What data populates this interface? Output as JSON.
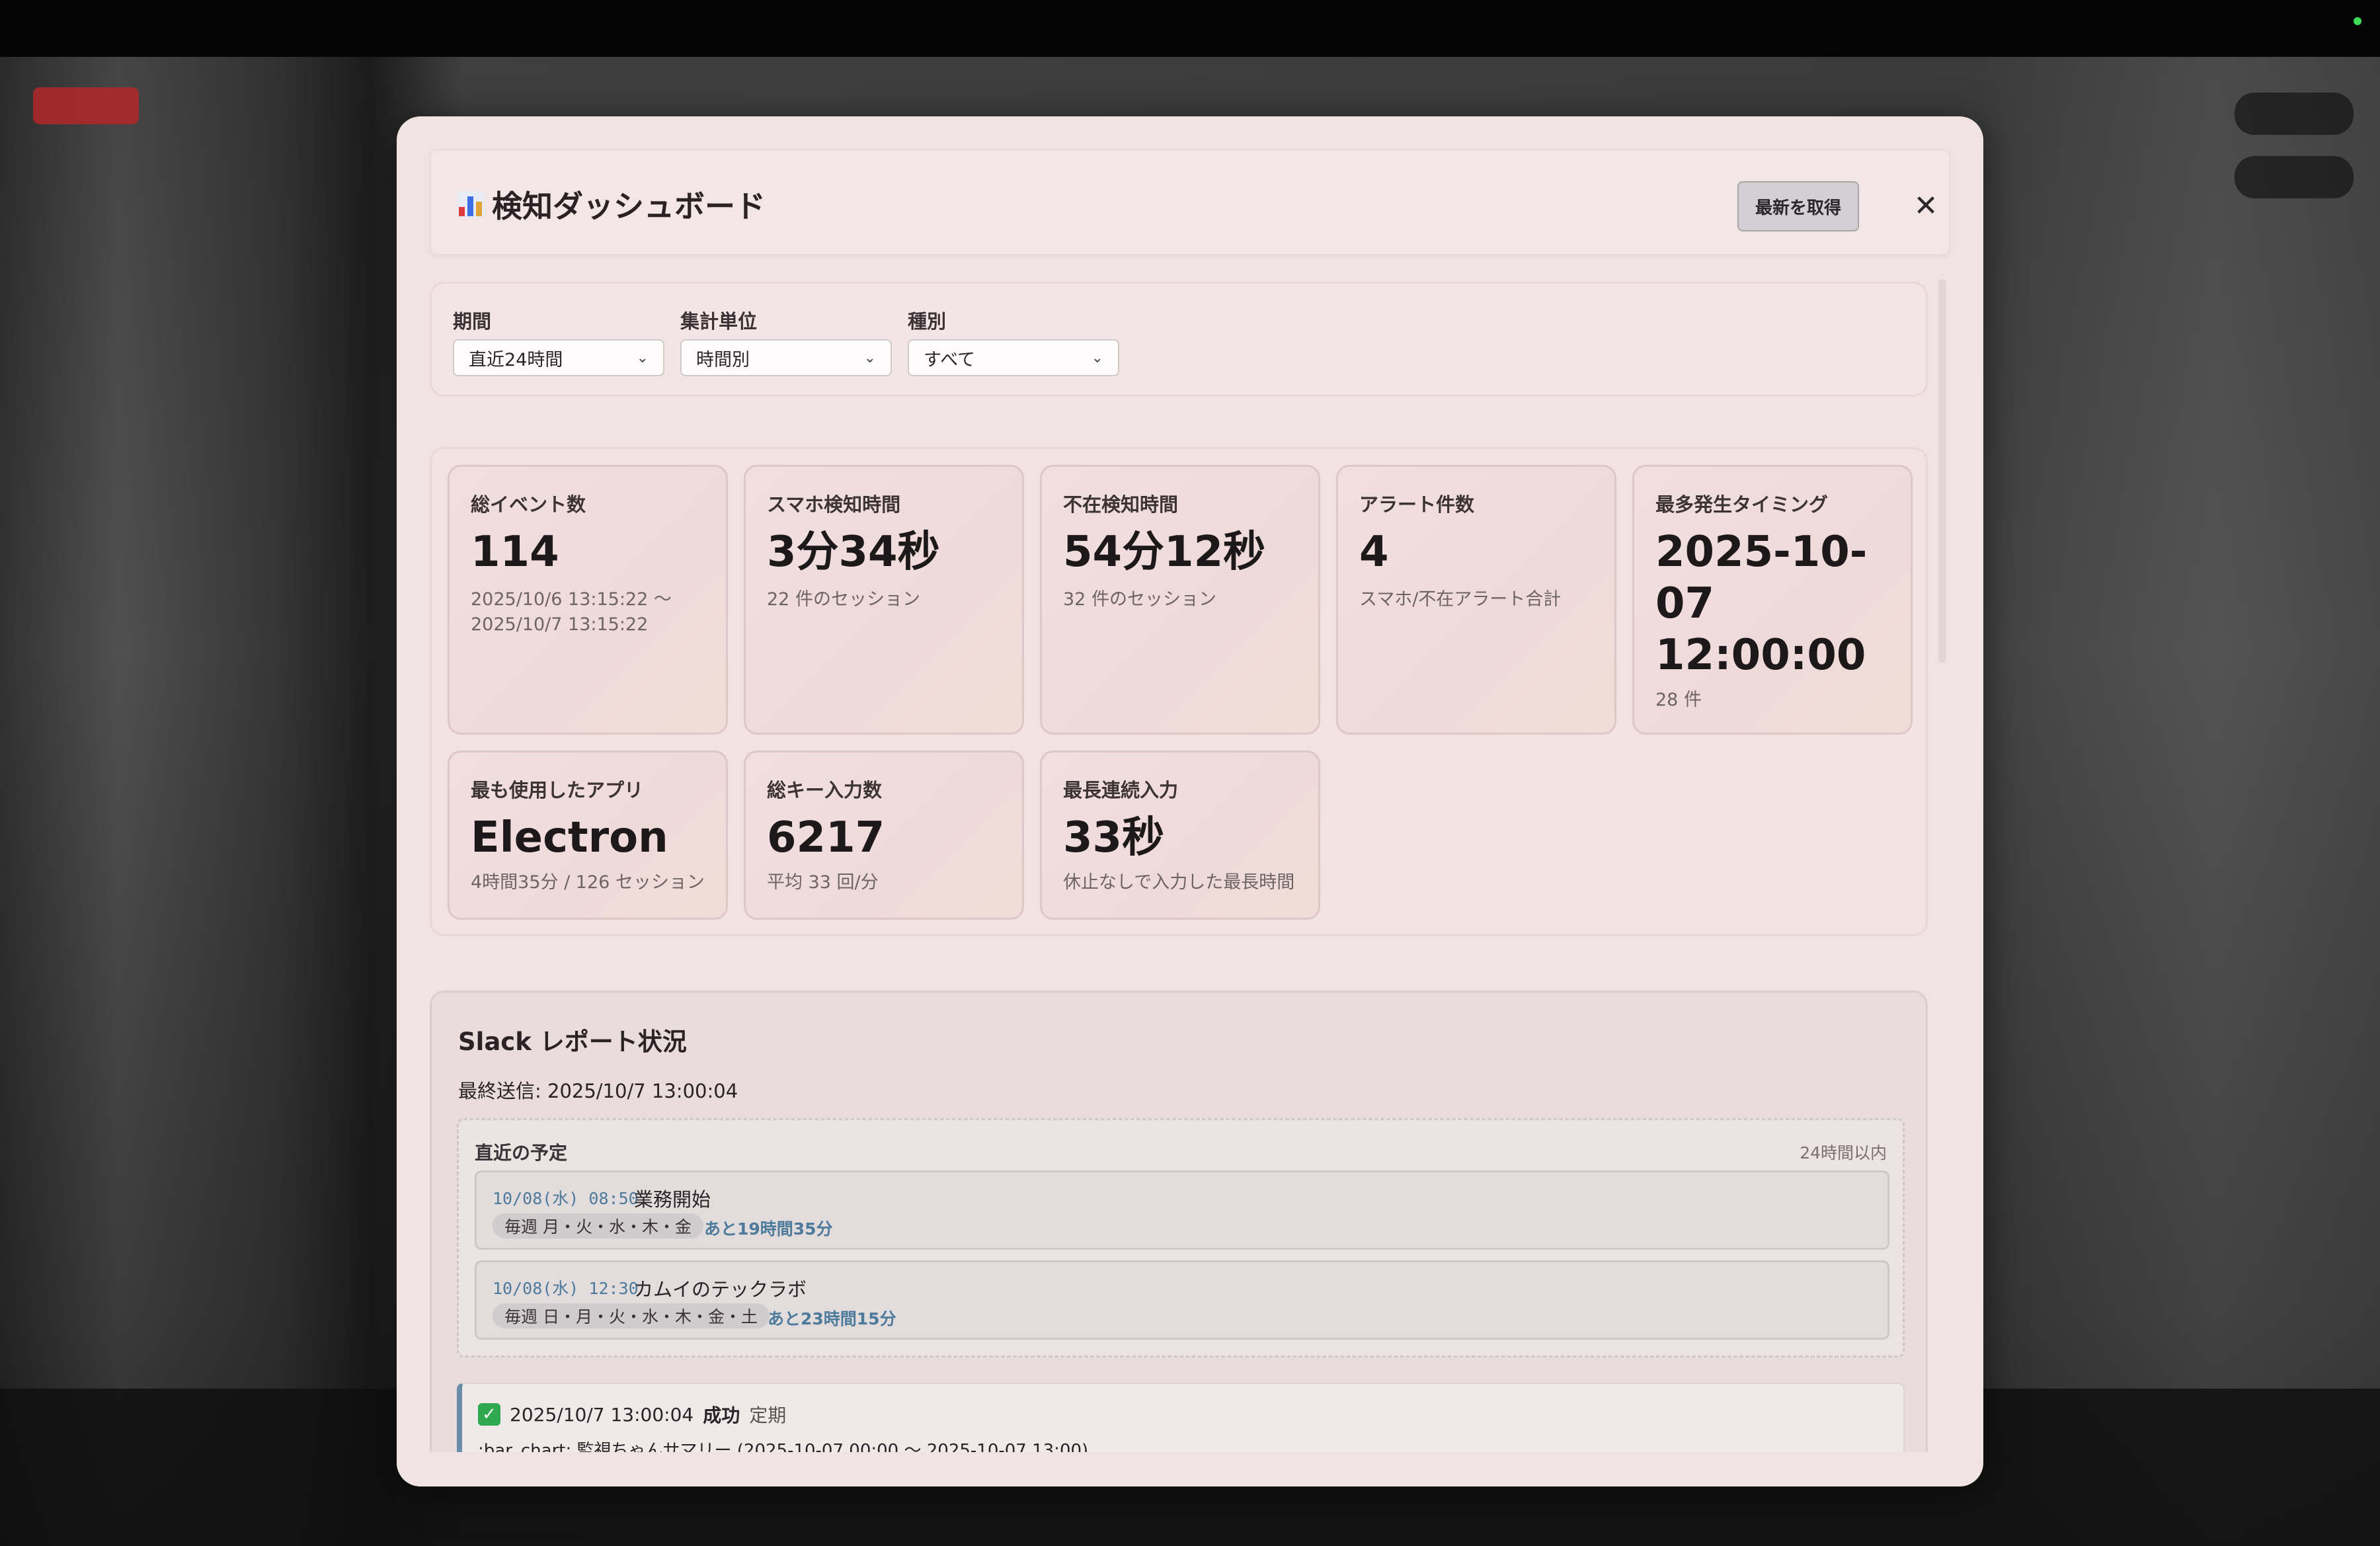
{
  "modal": {
    "title": "検知ダッシュボード",
    "refresh_label": "最新を取得",
    "close_label": "✕"
  },
  "filters": [
    {
      "label": "期間",
      "value": "直近24時間"
    },
    {
      "label": "集計単位",
      "value": "時間別"
    },
    {
      "label": "種別",
      "value": "すべて"
    }
  ],
  "stats": [
    {
      "label": "総イベント数",
      "value": "114",
      "sub": "2025/10/6 13:15:22 〜 2025/10/7 13:15:22"
    },
    {
      "label": "スマホ検知時間",
      "value": "3分34秒",
      "sub": "22 件のセッション"
    },
    {
      "label": "不在検知時間",
      "value": "54分12秒",
      "sub": "32 件のセッション"
    },
    {
      "label": "アラート件数",
      "value": "4",
      "sub": "スマホ/不在アラート合計"
    },
    {
      "label": "最多発生タイミング",
      "value": "2025-10-07 12:00:00",
      "sub": "28 件"
    },
    {
      "label": "最も使用したアプリ",
      "value": "Electron",
      "sub": "4時間35分 / 126 セッション"
    },
    {
      "label": "総キー入力数",
      "value": "6217",
      "sub": "平均 33 回/分"
    },
    {
      "label": "最長連続入力",
      "value": "33秒",
      "sub": "休止なしで入力した最長時間"
    }
  ],
  "slack": {
    "title": "Slack レポート状況",
    "last_sent": "最終送信: 2025/10/7 13:00:04",
    "schedule": {
      "heading": "直近の予定",
      "range": "24時間以内",
      "items": [
        {
          "time": "10/08(水) 08:50",
          "name": "業務開始",
          "repeat": "毎週 月・火・水・木・金",
          "remaining": "あと19時間35分"
        },
        {
          "time": "10/08(水) 12:30",
          "name": "カムイのテックラボ",
          "repeat": "毎週 日・月・火・水・木・金・土",
          "remaining": "あと23時間15分"
        }
      ]
    },
    "log": {
      "timestamp": "2025/10/7 13:00:04",
      "status": "成功",
      "kind": "定期",
      "message": ":bar_chart: 監視ちゃんサマリー (2025-10-07 00:00 〜 2025-10-07 13:00)"
    }
  },
  "colors": {
    "modal_bg": "#f1e3e3",
    "accent_blue": "#4e7a9c",
    "success_green": "#2fa84f"
  },
  "icons": [
    "bar-chart-icon",
    "close-icon",
    "chevron-down-icon",
    "check-icon"
  ]
}
